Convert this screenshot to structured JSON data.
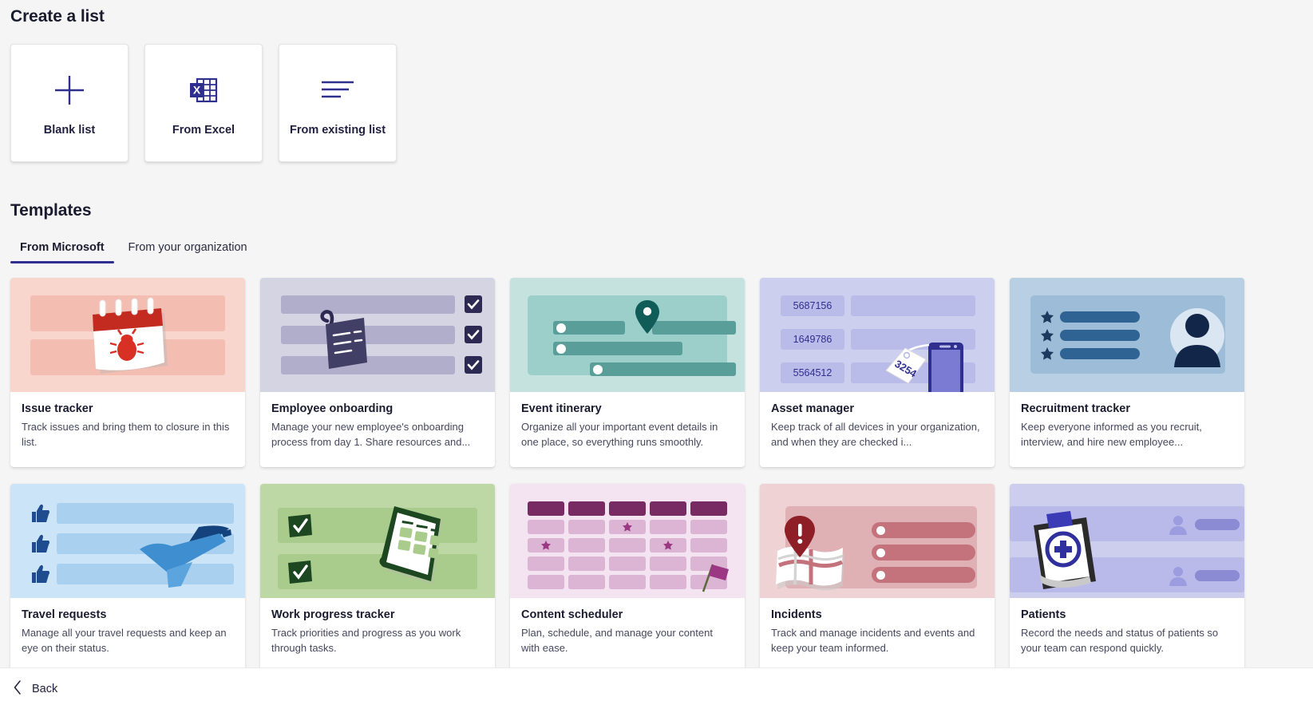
{
  "create": {
    "heading": "Create a list",
    "tiles": [
      {
        "label": "Blank list",
        "icon": "plus-icon"
      },
      {
        "label": "From Excel",
        "icon": "excel-icon"
      },
      {
        "label": "From existing list",
        "icon": "existing-list-icon"
      }
    ]
  },
  "templates": {
    "heading": "Templates",
    "tabs": [
      {
        "label": "From Microsoft",
        "active": true
      },
      {
        "label": "From your organization",
        "active": false
      }
    ],
    "cards": [
      {
        "title": "Issue tracker",
        "description": "Track issues and bring them to closure in this list.",
        "art": "issue-tracker-art",
        "accent": "#f0b4a8",
        "art_bg": "#f8d5cd"
      },
      {
        "title": "Employee onboarding",
        "description": "Manage your new employee's onboarding process from day 1. Share resources and...",
        "art": "employee-onboarding-art",
        "accent": "#b0aecb",
        "art_bg": "#d5d4e2"
      },
      {
        "title": "Event itinerary",
        "description": "Organize all your important event details in one place, so everything runs smoothly.",
        "art": "event-itinerary-art",
        "accent": "#6aa9a4",
        "art_bg": "#c5e2de"
      },
      {
        "title": "Asset manager",
        "description": "Keep track of all devices in your organization, and when they are checked i...",
        "art": "asset-manager-art",
        "accent": "#b9bbe8",
        "art_bg": "#cdcfee",
        "asset_ids": [
          "5687156",
          "1649786",
          "5564512"
        ],
        "tag_number": "3254"
      },
      {
        "title": "Recruitment tracker",
        "description": "Keep everyone informed as you recruit, interview, and hire new employee...",
        "art": "recruitment-tracker-art",
        "accent": "#9cbcd8",
        "art_bg": "#b9cfe3"
      },
      {
        "title": "Travel requests",
        "description": "Manage all your travel requests and keep an eye on their status.",
        "art": "travel-requests-art",
        "accent": "#a9d0ee",
        "art_bg": "#cbe4f7"
      },
      {
        "title": "Work progress tracker",
        "description": "Track priorities and progress as you work through tasks.",
        "art": "work-progress-art",
        "accent": "#a3c585",
        "art_bg": "#bdd8a4"
      },
      {
        "title": "Content scheduler",
        "description": "Plan, schedule, and manage your content with ease.",
        "art": "content-scheduler-art",
        "accent": "#782b63",
        "art_bg": "#f4e3f0"
      },
      {
        "title": "Incidents",
        "description": "Track and manage incidents and events and keep your team informed.",
        "art": "incidents-art",
        "accent": "#c4737c",
        "art_bg": "#eed2d4"
      },
      {
        "title": "Patients",
        "description": "Record the needs and status of patients so your team can respond quickly.",
        "art": "patients-art",
        "accent": "#8b8bd4",
        "art_bg": "#cdcdee"
      }
    ]
  },
  "footer": {
    "back_label": "Back"
  },
  "colors": {
    "brand": "#2f2f8f",
    "page_bg": "#f5f5f5",
    "card_bg": "#ffffff",
    "text": "#1b1b2f",
    "text_secondary": "#47475e"
  }
}
